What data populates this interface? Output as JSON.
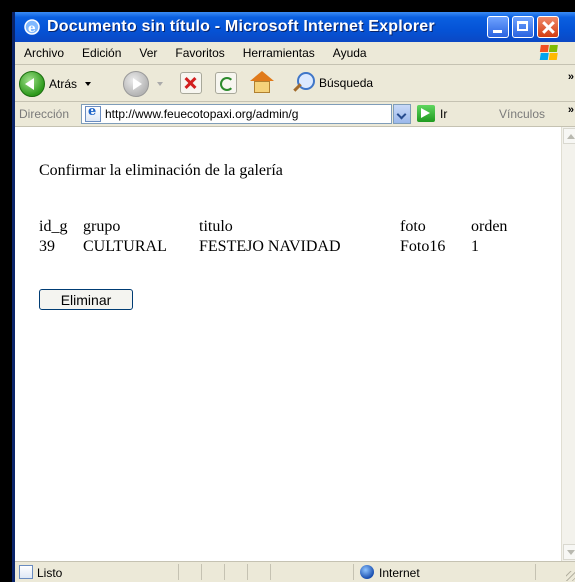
{
  "window": {
    "title": "Documento sin título - Microsoft Internet Explorer"
  },
  "menu": {
    "items": [
      "Archivo",
      "Edición",
      "Ver",
      "Favoritos",
      "Herramientas",
      "Ayuda"
    ]
  },
  "toolbar": {
    "back_label": "Atrás",
    "search_label": "Búsqueda",
    "overflow": "»"
  },
  "address": {
    "label": "Dirección",
    "url": "http://www.feuecotopaxi.org/admin/g",
    "go_label": "Ir",
    "links_label": "Vínculos",
    "links_overflow": "»"
  },
  "page": {
    "heading": "Confirmar la eliminación de la galería",
    "table": {
      "headers": [
        "id_g",
        "grupo",
        "titulo",
        "foto",
        "orden"
      ],
      "rows": [
        [
          "39",
          "CULTURAL",
          "FESTEJO NAVIDAD",
          "Foto16",
          "1"
        ]
      ]
    },
    "delete_button": "Eliminar"
  },
  "status": {
    "text": "Listo",
    "zone": "Internet"
  },
  "icons": {
    "back": "back-arrow-icon",
    "forward": "forward-arrow-icon",
    "stop": "stop-icon",
    "refresh": "refresh-icon",
    "home": "home-icon",
    "search": "search-icon",
    "go": "go-arrow-icon"
  },
  "colors": {
    "titlebar": "#0553d6",
    "close_button": "#d23c12",
    "chrome": "#ece9d8"
  }
}
